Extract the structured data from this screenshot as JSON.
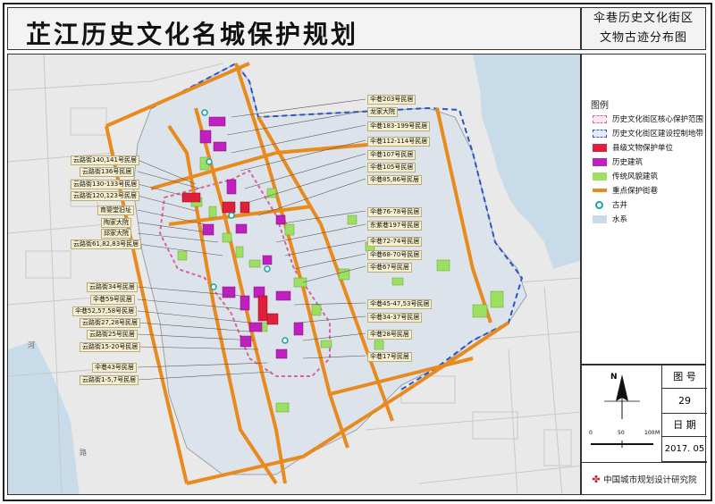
{
  "title": "芷江历史文化名城保护规划",
  "subtitle": [
    "伞巷历史文化街区",
    "文物古迹分布图"
  ],
  "legend": {
    "heading": "图例",
    "items": [
      {
        "label": "历史文化街区核心保护范围",
        "color": "#d8649a",
        "style": "dashed-outline"
      },
      {
        "label": "历史文化街区建设控制地带",
        "color": "#2b56c9",
        "style": "dashed-outline"
      },
      {
        "label": "县级文物保护单位",
        "color": "#e0203a",
        "style": "fill"
      },
      {
        "label": "历史建筑",
        "color": "#c020c0",
        "style": "fill"
      },
      {
        "label": "传统风貌建筑",
        "color": "#9be060",
        "style": "fill"
      },
      {
        "label": "重点保护街巷",
        "color": "#e88a1e",
        "style": "line"
      },
      {
        "label": "古井",
        "color": "#1aa3a3",
        "style": "well"
      },
      {
        "label": "水系",
        "color": "#c7dbe8",
        "style": "fill"
      }
    ]
  },
  "info": {
    "figure_no_label": "图 号",
    "figure_no": "29",
    "date_label": "日 期",
    "date": "2017. 05",
    "institute": "中国城市规划设计研究院"
  },
  "scale": {
    "ticks": [
      "0",
      "50",
      "100"
    ],
    "unit": "M"
  },
  "north": "N",
  "map_text": {
    "he": "河",
    "lu": "路"
  },
  "right_labels": [
    "伞巷203号民居",
    "龙家大院",
    "伞巷183-199号民居",
    "伞巷112-114号民居",
    "伞巷107号民居",
    "伞巷105号民居",
    "伞巷85,86号民居",
    "伞巷76-78号民居",
    "东紫巷197号民居",
    "伞巷72-74号民居",
    "伞巷68-70号民居",
    "伞巷67号民居",
    "伞巷45-47,53号民居",
    "伞巷34-37号民居",
    "伞巷28号民居",
    "伞巷17号民居"
  ],
  "left_labels": [
    "云路街140,141号民居",
    "云路街136号民居",
    "云路街130-133号民居",
    "云路街120,123号民居",
    "育婴堂旧址",
    "陶家大院",
    "邱家大院",
    "云路街61,82,83号民居",
    "云路街34号民居",
    "伞巷59号民居",
    "伞巷52,57,58号民居",
    "云路街27,28号民居",
    "云路街25号民居",
    "云路街15-20号民居",
    "伞巷43号民居",
    "云路街1-5,7号民居"
  ],
  "colors": {
    "street": "#e88a1e",
    "core": "#d8649a",
    "control": "#2b56c9",
    "county_relic": "#e0203a",
    "historic": "#c020c0",
    "traditional": "#9be060",
    "water": "#c7dbe8",
    "well": "#1aa3a3"
  }
}
